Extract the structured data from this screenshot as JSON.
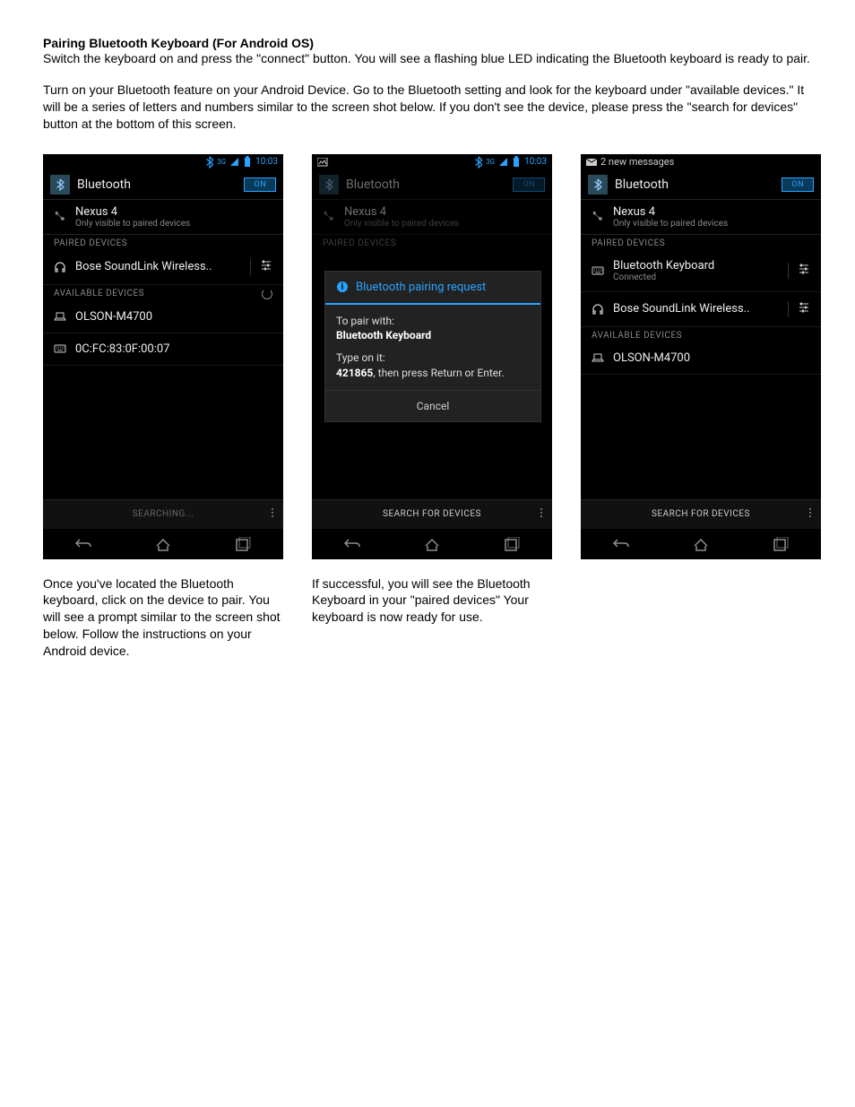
{
  "doc": {
    "heading": "Pairing Bluetooth Keyboard (For Android OS)",
    "para1": "Switch the keyboard on and press the \"connect\" button.  You will see a flashing blue LED indicating the Bluetooth keyboard is ready to pair.",
    "para2": "Turn on your Bluetooth feature on your Android Device.  Go to the Bluetooth setting and look for the keyboard under \"available devices.\"  It will be a series of letters and numbers similar to the screen shot below.  If you don't see the device, please press the \"search for devices\" button at the bottom of this screen."
  },
  "common": {
    "time": "10:03",
    "bt_title": "Bluetooth",
    "toggle": "ON",
    "my_device_name": "Nexus 4",
    "my_device_sub": "Only visible to paired devices",
    "paired_hdr": "PAIRED DEVICES",
    "avail_hdr": "AVAILABLE DEVICES",
    "search_btn": "SEARCH FOR DEVICES",
    "searching": "SEARCHING...",
    "bose": "Bose SoundLink Wireless..",
    "olson": "OLSON-M4700",
    "mac": "0C:FC:83:0F:00:07"
  },
  "screen2": {
    "dialog_title": "Bluetooth pairing request",
    "pair_with_label": "To pair with:",
    "pair_with_device": "Bluetooth Keyboard",
    "type_label": "Type on it:",
    "pin": "421865",
    "pin_suffix": ", then press Return or Enter.",
    "cancel": "Cancel"
  },
  "screen3": {
    "notif": "2 new messages",
    "kbd_name": "Bluetooth  Keyboard",
    "kbd_status": "Connected"
  },
  "captions": {
    "c1": "Once you've located the Bluetooth keyboard, click on the device to pair. You will see a prompt similar to the screen shot below.  Follow the instructions on your Android device.",
    "c2": "If successful, you will see the Bluetooth Keyboard in your \"paired devices\"  Your keyboard is now ready for use."
  }
}
